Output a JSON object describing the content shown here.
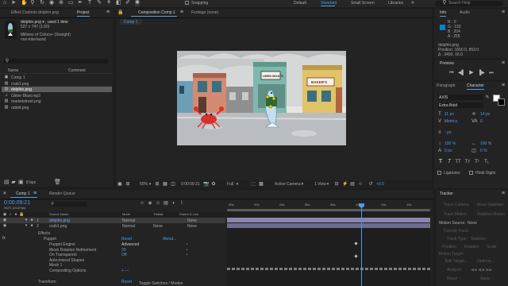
{
  "toolbar": {
    "snapping_label": "Snapping",
    "workspaces": [
      "Default",
      "Standard",
      "Small Screen",
      "Libraries"
    ],
    "active_workspace": "Standard",
    "search_placeholder": "Search Help"
  },
  "project_panel": {
    "tabs": [
      "Effect Controls dolphin.png",
      "Project"
    ],
    "asset_name": "dolphin.png ▾ , used 1 time",
    "asset_size": "527 x 747 (1.00)",
    "asset_color": "Millions of Colors+ (Straight)",
    "asset_interlace": "non-interlaced",
    "search_placeholder": "",
    "col_name": "Name",
    "col_comment": "Comment",
    "items": [
      {
        "label": "Comp 1",
        "kind": "comp"
      },
      {
        "label": "crab1.png",
        "kind": "image"
      },
      {
        "label": "dolphin.png",
        "kind": "image",
        "selected": true
      },
      {
        "label": "Glitter Blast.mp3",
        "kind": "audio"
      },
      {
        "label": "marketstreet.png",
        "kind": "image"
      },
      {
        "label": "rabbit.png",
        "kind": "image"
      }
    ],
    "bit_depth": "8 bpc"
  },
  "viewer": {
    "tabs": [
      "Composition Comp 1",
      "Footage (none)"
    ],
    "sub_tab": "Comp 1",
    "zoom": "50%",
    "timecode": "0:00:09:21",
    "resolution": "Full",
    "camera": "Active Camera",
    "views": "1 View",
    "exposure": "+0.0",
    "shop_signs": [
      "USED BOATS",
      "BAKER'S"
    ]
  },
  "info_panel": {
    "tabs": [
      "Info",
      "Audio"
    ],
    "r": "R : 0",
    "g": "G : 133",
    "b": "B : 204",
    "a": "A : 255",
    "swatch": "#0085cc",
    "line1": "dolphin.png",
    "line2": "Position: 1650.0, 853.0",
    "line3": "  Δ : 3400, 16.0"
  },
  "preview_panel": {
    "title": "Preview"
  },
  "character_panel": {
    "tabs": [
      "Paragraph",
      "Character"
    ],
    "font": "AXIS",
    "style": "Extra Bold",
    "size": "11 px",
    "leading": "14 px",
    "kerning": "Metrics",
    "tracking": "0",
    "stroke_unit": "- px",
    "vscale": "100 %",
    "hscale": "100 %",
    "baseline": "0 px",
    "tsume": "0 %",
    "ligatures": "Ligatures",
    "hindi": "Hindi Digits"
  },
  "tracker_panel": {
    "title": "Tracker",
    "buttons": [
      "Track Camera",
      "Warp Stabilizer",
      "Track Motion",
      "Stabilize Motion"
    ],
    "motion_source_label": "Motion Source:",
    "motion_source": "None",
    "current_track": "Current Track:",
    "track_type": "Track Type:",
    "track_type_val": "Stabilize",
    "options": [
      "Position",
      "Rotation",
      "Scale"
    ],
    "motion_target": "Motion Target:",
    "edit_target": "Edit Target...",
    "options_btn": "Options...",
    "analyze": "Analyze:",
    "reset": "Reset",
    "apply": "Apply"
  },
  "timeline": {
    "tabs": [
      "Comp 1",
      "Render Queue"
    ],
    "timecode": "0:00:09:21",
    "frames": "00271 (24.00 fps)",
    "col_source": "Source Name",
    "col_mode": "Mode",
    "col_trkmat": "TrkMat",
    "col_parent": "Parent & Link",
    "layers": [
      {
        "num": "1",
        "name": "dolphin.png",
        "mode": "Normal",
        "parent": "None",
        "selected": true
      },
      {
        "num": "2",
        "name": "crab1.png",
        "mode": "Normal",
        "trkmat": "None",
        "parent": "None"
      }
    ],
    "effects_label": "Effects",
    "puppet_label": "Puppet",
    "puppet_reset": "Reset",
    "puppet_about": "About...",
    "props": [
      {
        "label": "Puppet Engine",
        "value": "Advanced"
      },
      {
        "label": "Mesh Rotation Refinement",
        "value": "20"
      },
      {
        "label": "On Transparent",
        "value": "Off"
      },
      {
        "label": "Auto-traced Shapes",
        "value": ""
      },
      {
        "label": "Mesh 1",
        "value": ""
      },
      {
        "label": "Compositing Options",
        "value": "+ —"
      }
    ],
    "transform_label": "Transform",
    "transform_reset": "Reset",
    "toggle_label": "Toggle Switches / Modes",
    "ruler": [
      "00s",
      "02s",
      "04s",
      "06s",
      "08s",
      "10s",
      "12s",
      "14s"
    ],
    "playhead_fraction": 0.66
  }
}
